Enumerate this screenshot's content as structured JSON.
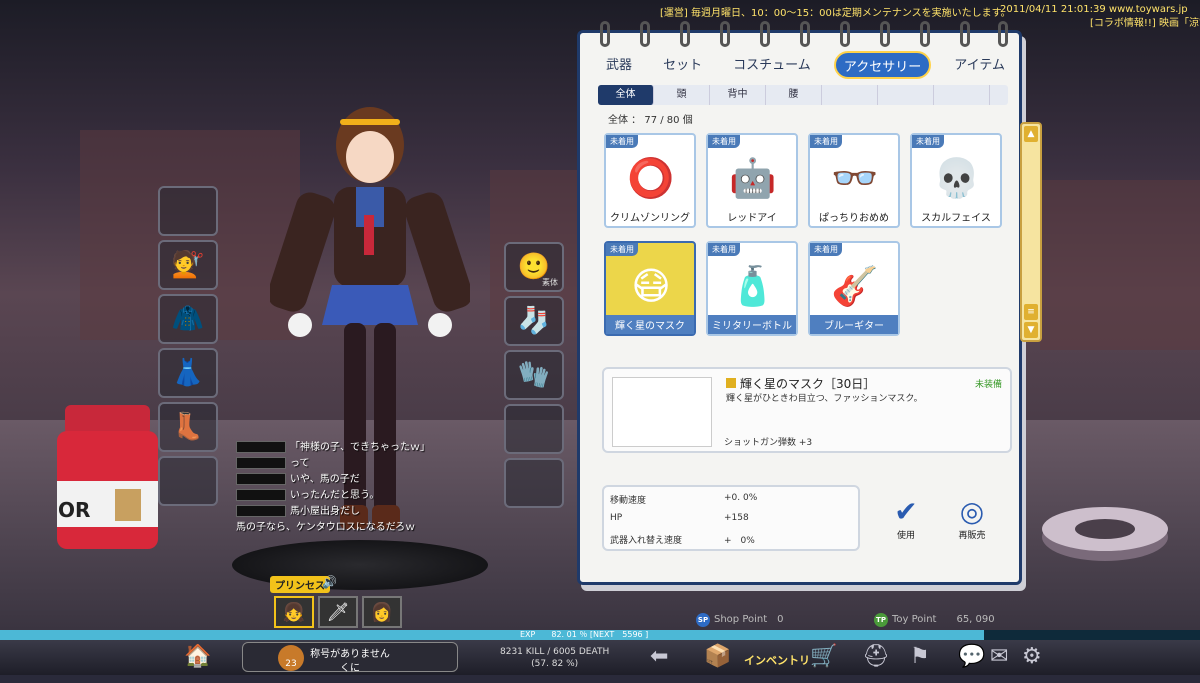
{
  "ticker": {
    "notice": "[運営] 毎週月曜日、10：00～15：00は定期メンテナンスを実施いたします。",
    "timestamp": "2011/04/11 21:01:39",
    "site": "www.toywars.jp",
    "notice2": "[コラボ情報!!] 映画「涼宮"
  },
  "left_slots": [
    {
      "icon": "",
      "name": "empty"
    },
    {
      "icon": "💇",
      "name": "hair"
    },
    {
      "icon": "🧥",
      "name": "top"
    },
    {
      "icon": "👗",
      "name": "skirt"
    },
    {
      "icon": "👢",
      "name": "shoes"
    },
    {
      "icon": "",
      "name": "empty"
    }
  ],
  "right_slots": [
    {
      "icon": "🙂",
      "tag": "素体"
    },
    {
      "icon": "🧦",
      "tag": ""
    },
    {
      "icon": "🧤",
      "tag": ""
    },
    {
      "icon": "",
      "tag": ""
    },
    {
      "icon": "",
      "tag": ""
    }
  ],
  "chat": [
    {
      "text": "「神様の子、できちゃったｗ」"
    },
    {
      "text": "って"
    },
    {
      "text": "いや、馬の子だ"
    },
    {
      "text": "いったんだと思う。"
    },
    {
      "text": "馬小屋出身だし"
    },
    {
      "text": "馬の子なら、ケンタウロスになるだろｗ"
    }
  ],
  "character": {
    "title_badge": "プリンセス"
  },
  "jar_label": "OR",
  "inventory": {
    "tabs": [
      "武器",
      "セット",
      "コスチューム",
      "アクセサリー",
      "アイテム"
    ],
    "active_tab": "アクセサリー",
    "subtabs": [
      "全体",
      "頭",
      "背中",
      "腰",
      "",
      "",
      ""
    ],
    "count_text": "全体 ： 77 / 80 個",
    "badge": "未着用",
    "items": [
      {
        "name": "クリムゾンリング",
        "icon": "⭕"
      },
      {
        "name": "レッドアイ",
        "icon": "🤖"
      },
      {
        "name": "ぱっちりおめめ",
        "icon": "👓"
      },
      {
        "name": "スカルフェイス",
        "icon": "💀"
      },
      {
        "name": "輝く星のマスク",
        "icon": "😷"
      },
      {
        "name": "ミリタリーボトル",
        "icon": "🧴"
      },
      {
        "name": "ブルーギター",
        "icon": "🎸"
      }
    ],
    "selected_item": "輝く星のマスク"
  },
  "detail": {
    "title": "輝く星のマスク［30日］",
    "state": "未装備",
    "description": "輝く星がひときわ目立つ、ファッションマスク。",
    "effect": "ショットガン弾数 +3",
    "icon": "😷"
  },
  "stats": [
    {
      "label": "移動速度",
      "value": "+0. 0%"
    },
    {
      "label": "HP",
      "value": "+158"
    },
    {
      "label": "武器入れ替え速度",
      "value": "+　0%"
    }
  ],
  "actions": {
    "use": "使用",
    "resell": "再販売"
  },
  "points": {
    "shop_label": "Shop Point",
    "shop_value": "0",
    "toy_label": "Toy Point",
    "toy_value": "65, 090"
  },
  "exp": {
    "text": "EXP　　82. 01 ％ [NEXT　5596 ]",
    "fill": 0.82
  },
  "bottom": {
    "title_line1": "称号がありません",
    "title_line2": "くに",
    "level": "23",
    "kd_line1": "8231 KILL / 6005 DEATH",
    "kd_line2": "(57. 82 %)",
    "inventory_label": "インベントリ"
  },
  "colors": {
    "accent": "#2d6bc4",
    "highlight": "#ecd64a",
    "navy": "#1f3a6a"
  }
}
